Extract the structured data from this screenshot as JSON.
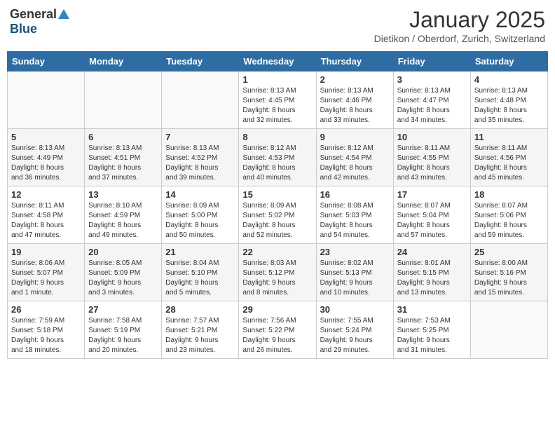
{
  "header": {
    "logo_general": "General",
    "logo_blue": "Blue",
    "month": "January 2025",
    "location": "Dietikon / Oberdorf, Zurich, Switzerland"
  },
  "weekdays": [
    "Sunday",
    "Monday",
    "Tuesday",
    "Wednesday",
    "Thursday",
    "Friday",
    "Saturday"
  ],
  "weeks": [
    [
      {
        "day": "",
        "info": ""
      },
      {
        "day": "",
        "info": ""
      },
      {
        "day": "",
        "info": ""
      },
      {
        "day": "1",
        "info": "Sunrise: 8:13 AM\nSunset: 4:45 PM\nDaylight: 8 hours\nand 32 minutes."
      },
      {
        "day": "2",
        "info": "Sunrise: 8:13 AM\nSunset: 4:46 PM\nDaylight: 8 hours\nand 33 minutes."
      },
      {
        "day": "3",
        "info": "Sunrise: 8:13 AM\nSunset: 4:47 PM\nDaylight: 8 hours\nand 34 minutes."
      },
      {
        "day": "4",
        "info": "Sunrise: 8:13 AM\nSunset: 4:48 PM\nDaylight: 8 hours\nand 35 minutes."
      }
    ],
    [
      {
        "day": "5",
        "info": "Sunrise: 8:13 AM\nSunset: 4:49 PM\nDaylight: 8 hours\nand 36 minutes."
      },
      {
        "day": "6",
        "info": "Sunrise: 8:13 AM\nSunset: 4:51 PM\nDaylight: 8 hours\nand 37 minutes."
      },
      {
        "day": "7",
        "info": "Sunrise: 8:13 AM\nSunset: 4:52 PM\nDaylight: 8 hours\nand 39 minutes."
      },
      {
        "day": "8",
        "info": "Sunrise: 8:12 AM\nSunset: 4:53 PM\nDaylight: 8 hours\nand 40 minutes."
      },
      {
        "day": "9",
        "info": "Sunrise: 8:12 AM\nSunset: 4:54 PM\nDaylight: 8 hours\nand 42 minutes."
      },
      {
        "day": "10",
        "info": "Sunrise: 8:11 AM\nSunset: 4:55 PM\nDaylight: 8 hours\nand 43 minutes."
      },
      {
        "day": "11",
        "info": "Sunrise: 8:11 AM\nSunset: 4:56 PM\nDaylight: 8 hours\nand 45 minutes."
      }
    ],
    [
      {
        "day": "12",
        "info": "Sunrise: 8:11 AM\nSunset: 4:58 PM\nDaylight: 8 hours\nand 47 minutes."
      },
      {
        "day": "13",
        "info": "Sunrise: 8:10 AM\nSunset: 4:59 PM\nDaylight: 8 hours\nand 49 minutes."
      },
      {
        "day": "14",
        "info": "Sunrise: 8:09 AM\nSunset: 5:00 PM\nDaylight: 8 hours\nand 50 minutes."
      },
      {
        "day": "15",
        "info": "Sunrise: 8:09 AM\nSunset: 5:02 PM\nDaylight: 8 hours\nand 52 minutes."
      },
      {
        "day": "16",
        "info": "Sunrise: 8:08 AM\nSunset: 5:03 PM\nDaylight: 8 hours\nand 54 minutes."
      },
      {
        "day": "17",
        "info": "Sunrise: 8:07 AM\nSunset: 5:04 PM\nDaylight: 8 hours\nand 57 minutes."
      },
      {
        "day": "18",
        "info": "Sunrise: 8:07 AM\nSunset: 5:06 PM\nDaylight: 8 hours\nand 59 minutes."
      }
    ],
    [
      {
        "day": "19",
        "info": "Sunrise: 8:06 AM\nSunset: 5:07 PM\nDaylight: 9 hours\nand 1 minute."
      },
      {
        "day": "20",
        "info": "Sunrise: 8:05 AM\nSunset: 5:09 PM\nDaylight: 9 hours\nand 3 minutes."
      },
      {
        "day": "21",
        "info": "Sunrise: 8:04 AM\nSunset: 5:10 PM\nDaylight: 9 hours\nand 5 minutes."
      },
      {
        "day": "22",
        "info": "Sunrise: 8:03 AM\nSunset: 5:12 PM\nDaylight: 9 hours\nand 8 minutes."
      },
      {
        "day": "23",
        "info": "Sunrise: 8:02 AM\nSunset: 5:13 PM\nDaylight: 9 hours\nand 10 minutes."
      },
      {
        "day": "24",
        "info": "Sunrise: 8:01 AM\nSunset: 5:15 PM\nDaylight: 9 hours\nand 13 minutes."
      },
      {
        "day": "25",
        "info": "Sunrise: 8:00 AM\nSunset: 5:16 PM\nDaylight: 9 hours\nand 15 minutes."
      }
    ],
    [
      {
        "day": "26",
        "info": "Sunrise: 7:59 AM\nSunset: 5:18 PM\nDaylight: 9 hours\nand 18 minutes."
      },
      {
        "day": "27",
        "info": "Sunrise: 7:58 AM\nSunset: 5:19 PM\nDaylight: 9 hours\nand 20 minutes."
      },
      {
        "day": "28",
        "info": "Sunrise: 7:57 AM\nSunset: 5:21 PM\nDaylight: 9 hours\nand 23 minutes."
      },
      {
        "day": "29",
        "info": "Sunrise: 7:56 AM\nSunset: 5:22 PM\nDaylight: 9 hours\nand 26 minutes."
      },
      {
        "day": "30",
        "info": "Sunrise: 7:55 AM\nSunset: 5:24 PM\nDaylight: 9 hours\nand 29 minutes."
      },
      {
        "day": "31",
        "info": "Sunrise: 7:53 AM\nSunset: 5:25 PM\nDaylight: 9 hours\nand 31 minutes."
      },
      {
        "day": "",
        "info": ""
      }
    ]
  ]
}
